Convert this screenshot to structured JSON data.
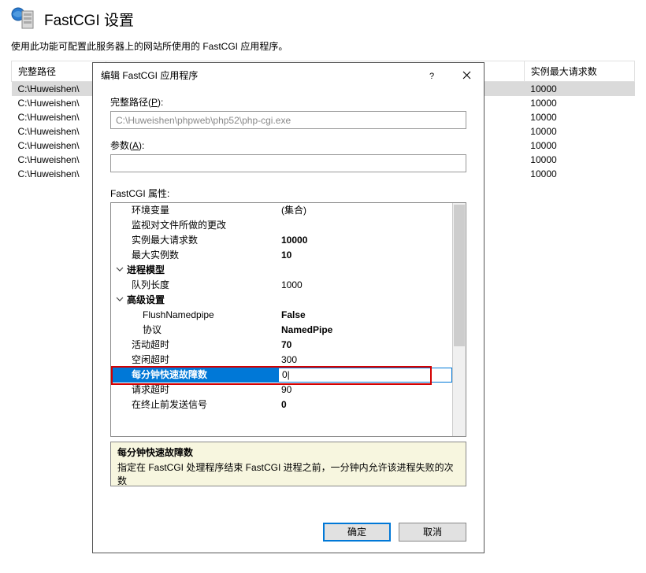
{
  "page": {
    "title": "FastCGI 设置",
    "description": "使用此功能可配置此服务器上的网站所使用的 FastCGI 应用程序。"
  },
  "table": {
    "headers": {
      "path": "完整路径",
      "maxreq": "实例最大请求数"
    },
    "rows": [
      {
        "path": "C:\\Huweishen\\",
        "maxreq": "10000",
        "selected": true
      },
      {
        "path": "C:\\Huweishen\\",
        "maxreq": "10000"
      },
      {
        "path": "C:\\Huweishen\\",
        "maxreq": "10000"
      },
      {
        "path": "C:\\Huweishen\\",
        "maxreq": "10000"
      },
      {
        "path": "C:\\Huweishen\\",
        "maxreq": "10000"
      },
      {
        "path": "C:\\Huweishen\\",
        "maxreq": "10000"
      },
      {
        "path": "C:\\Huweishen\\",
        "maxreq": "10000"
      }
    ]
  },
  "dialog": {
    "title": "编辑 FastCGI 应用程序",
    "fullpath_label_pre": "完整路径(",
    "fullpath_label_u": "P",
    "fullpath_label_post": "):",
    "fullpath_value": "C:\\Huweishen\\phpweb\\php52\\php-cgi.exe",
    "args_label_pre": "参数(",
    "args_label_u": "A",
    "args_label_post": "):",
    "args_value": "",
    "props_label": "FastCGI 属性:",
    "properties": [
      {
        "name": "环境变量",
        "value": "(集合)",
        "indent": true
      },
      {
        "name": "监视对文件所做的更改",
        "value": "",
        "indent": true
      },
      {
        "name": "实例最大请求数",
        "value": "10000",
        "indent": true,
        "bold": true
      },
      {
        "name": "最大实例数",
        "value": "10",
        "indent": true,
        "bold": true
      },
      {
        "name": "进程模型",
        "cat": true
      },
      {
        "name": "队列长度",
        "value": "1000",
        "indent": true
      },
      {
        "name": "高级设置",
        "cat": true
      },
      {
        "name": "FlushNamedpipe",
        "value": "False",
        "indent2": true,
        "bold": true
      },
      {
        "name": "协议",
        "value": "NamedPipe",
        "indent2": true,
        "bold": true
      },
      {
        "name": "活动超时",
        "value": "70",
        "indent": true,
        "bold": true
      },
      {
        "name": "空闲超时",
        "value": "300",
        "indent": true
      },
      {
        "name": "每分钟快速故障数",
        "value": "0",
        "indent": true,
        "selected": true,
        "boldname": true
      },
      {
        "name": "请求超时",
        "value": "90",
        "indent": true
      },
      {
        "name": "在终止前发送信号",
        "value": "0",
        "indent": true,
        "bold": true
      }
    ],
    "help": {
      "title": "每分钟快速故障数",
      "text": "指定在 FastCGI 处理程序结束 FastCGI 进程之前，一分钟内允许该进程失败的次数"
    },
    "ok": "确定",
    "cancel": "取消"
  }
}
